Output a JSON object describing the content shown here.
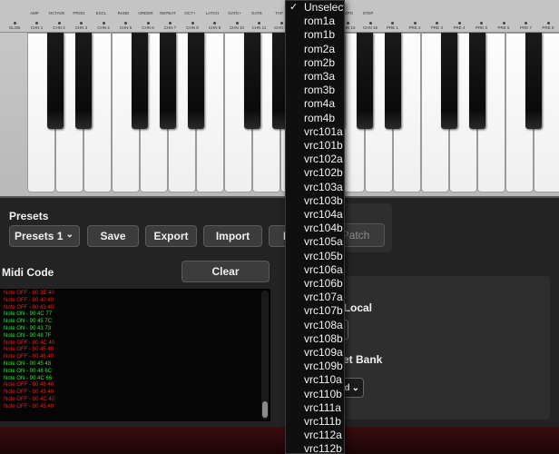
{
  "keyboard": {
    "labels_top": [
      "AMP",
      "OCTAVE",
      "PROG",
      "EXCL",
      "RAND",
      "ORDER",
      "REPEAT",
      "OCT+",
      "LATCH",
      "GATE+",
      "GATE",
      "TAP",
      "TEMPO-",
      "TEMPO+",
      "TEMPO",
      "STEP"
    ],
    "labels_bottom": [
      "GLOB",
      "CHN 1",
      "CHN 2",
      "CHN 3",
      "CHN 4",
      "CHN 5",
      "CHN 6",
      "CHN 7",
      "CHN 8",
      "CHN 9",
      "CHN 10",
      "CHN 11",
      "CHN 12",
      "CHN 13",
      "CHN 14",
      "CHN 15",
      "CHN 16",
      "PRE 1",
      "PRE 2",
      "PRE 3",
      "PRE 4",
      "PRE 5",
      "PRE 6",
      "PRE 7",
      "PRE 8"
    ],
    "white_key_count": 19,
    "black_key_positions": [
      1,
      2,
      4,
      5,
      6,
      8,
      9,
      11,
      12,
      13,
      15,
      16,
      18
    ]
  },
  "presets": {
    "title": "Presets",
    "selected": "Presets 1",
    "save_label": "Save",
    "export_label": "Export",
    "import_label": "Import",
    "partial_label": "R"
  },
  "midi": {
    "title": "Midi Code",
    "clear_label": "Clear",
    "log": [
      {
        "text": "Note OFF - 80 3E 40",
        "type": "off"
      },
      {
        "text": "Note OFF - 80 40 40",
        "type": "off"
      },
      {
        "text": "Note OFF - 80 43 40",
        "type": "off"
      },
      {
        "text": "Note ON - 90 4C 77",
        "type": "on"
      },
      {
        "text": "Note ON - 90 45 7C",
        "type": "on"
      },
      {
        "text": "Note ON - 90 43 73",
        "type": "on"
      },
      {
        "text": "Note ON - 90 48 7F",
        "type": "on"
      },
      {
        "text": "Note OFF - 80 4C 40",
        "type": "off"
      },
      {
        "text": "Note OFF - 80 45 40",
        "type": "off"
      },
      {
        "text": "Note OFF - 80 48 40",
        "type": "off"
      },
      {
        "text": "Note ON - 90 45 48",
        "type": "on"
      },
      {
        "text": "Note ON - 90 48 6C",
        "type": "on"
      },
      {
        "text": "Note ON - 90 4C 66",
        "type": "on"
      },
      {
        "text": "Note OFF - 80 48 40",
        "type": "off"
      },
      {
        "text": "Note OFF - 80 43 40",
        "type": "off"
      },
      {
        "text": "Note OFF - 80 4C 40",
        "type": "off"
      },
      {
        "text": "Note OFF - 80 45 40",
        "type": "off"
      }
    ]
  },
  "right_panel": {
    "patch_label": "Patch",
    "local_label": "n Local",
    "bank_label": "et Bank",
    "bank_value": "d"
  },
  "dropdown": {
    "selected": "Unselect",
    "items": [
      "Unselect",
      "rom1a",
      "rom1b",
      "rom2a",
      "rom2b",
      "rom3a",
      "rom3b",
      "rom4a",
      "rom4b",
      "vrc101a",
      "vrc101b",
      "vrc102a",
      "vrc102b",
      "vrc103a",
      "vrc103b",
      "vrc104a",
      "vrc104b",
      "vrc105a",
      "vrc105b",
      "vrc106a",
      "vrc106b",
      "vrc107a",
      "vrc107b",
      "vrc108a",
      "vrc108b",
      "vrc109a",
      "vrc109b",
      "vrc110a",
      "vrc110b",
      "vrc111a",
      "vrc111b",
      "vrc112a",
      "vrc112b"
    ]
  },
  "colors": {
    "log_off": "#e61f1f",
    "log_on": "#2be83a",
    "panel": "#232323",
    "menu_bg": "#0f0f0f"
  }
}
